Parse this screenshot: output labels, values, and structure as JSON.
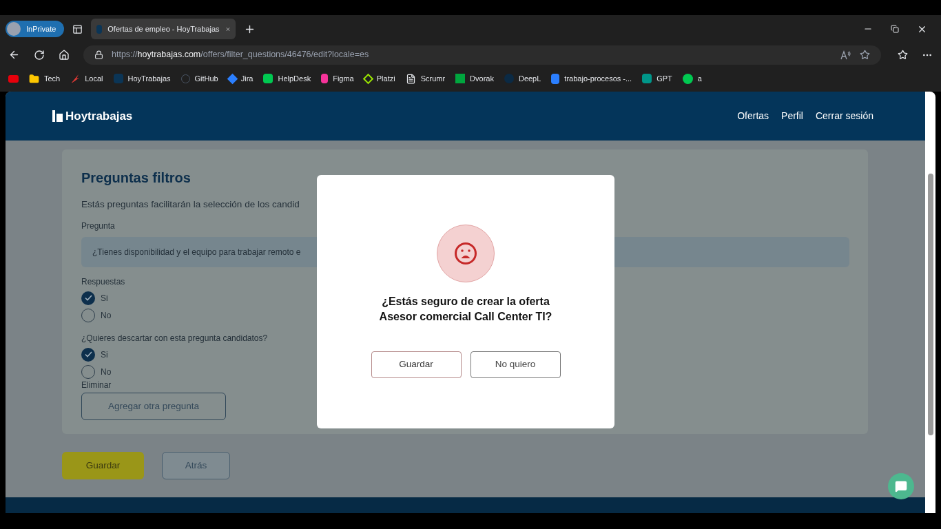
{
  "browser": {
    "profile": "InPrivate",
    "tabs": [
      {
        "title": "Ofertas de empleo - HoyTrabajas",
        "selected": true
      }
    ],
    "address": {
      "scheme": "https://",
      "host": "hoytrabajas.com",
      "path": "/offers/filter_questions/46476/edit?locale=es"
    },
    "bookmarks": [
      "Tech",
      "Local",
      "HoyTrabajas",
      "GitHub",
      "Jira",
      "HelpDesk",
      "Figma",
      "Platzi",
      "Scrumr",
      "Dvorak",
      "DeepL",
      "trabajo-procesos -...",
      "GPT",
      "a"
    ]
  },
  "site": {
    "logo": "Hoytrabajas",
    "nav": [
      "Ofertas",
      "Perfil",
      "Cerrar sesión"
    ]
  },
  "form": {
    "title": "Preguntas filtros",
    "description": "Estás preguntas facilitarán la selección de los candid",
    "question_label": "Pregunta",
    "question_value": "¿Tienes disponibilidad y el equipo para trabajar remoto e",
    "groups": [
      {
        "label": "Respuestas",
        "options": [
          {
            "label": "Si",
            "selected": true
          },
          {
            "label": "No",
            "selected": false
          }
        ]
      },
      {
        "label": "¿Quieres descartar con esta pregunta candidatos?",
        "options": [
          {
            "label": "Si",
            "selected": true
          },
          {
            "label": "No",
            "selected": false
          }
        ]
      }
    ],
    "delete_link": "Eliminar",
    "add_button": "Agregar otra pregunta",
    "save_button": "Guardar",
    "back_button": "Atrás"
  },
  "modal": {
    "message_lines": [
      "¿Estás seguro de crear la oferta",
      "Asesor comercial Call Center TI?"
    ],
    "confirm_button": "Guardar",
    "cancel_button": "No quiero"
  }
}
